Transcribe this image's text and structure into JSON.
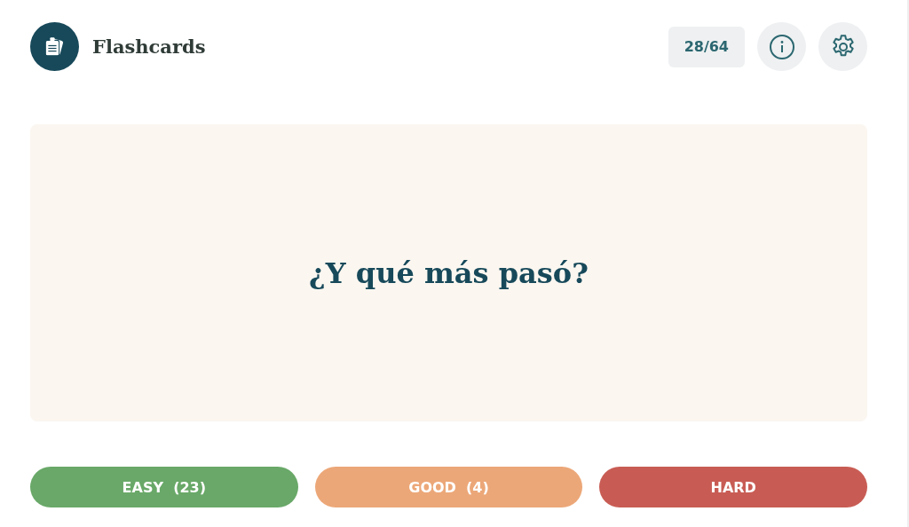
{
  "header": {
    "title": "Flashcards",
    "progress": "28/64"
  },
  "card": {
    "text": "¿Y qué más pasó?"
  },
  "answers": [
    {
      "label": "EASY  (23)",
      "color": "#69a868"
    },
    {
      "label": "GOOD  (4)",
      "color": "#eca778"
    },
    {
      "label": "HARD",
      "color": "#c85c54"
    }
  ]
}
